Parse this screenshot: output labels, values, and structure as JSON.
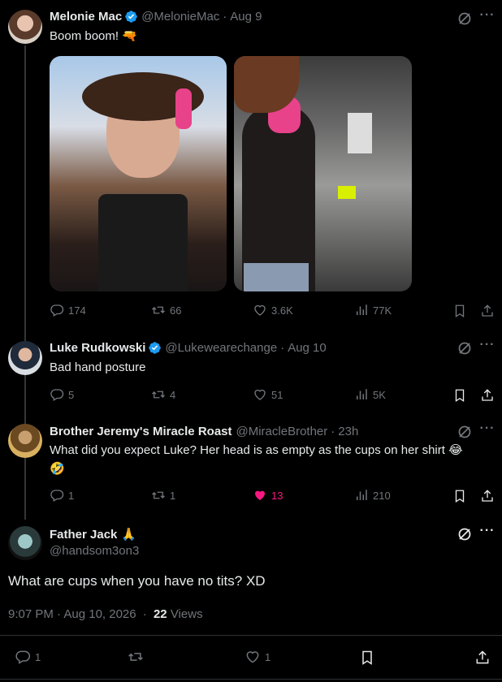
{
  "tweets": [
    {
      "name": "Melonie Mac",
      "handle": "@MelonieMac",
      "time": "Aug 9",
      "text": "Boom boom! 🔫",
      "replies": "174",
      "reposts": "66",
      "likes": "3.6K",
      "views": "77K"
    },
    {
      "name": "Luke Rudkowski",
      "handle": "@Lukewearechange",
      "time": "Aug 10",
      "text": "Bad hand posture",
      "replies": "5",
      "reposts": "4",
      "likes": "51",
      "views": "5K"
    },
    {
      "name": "Brother Jeremy's Miracle Roast",
      "handle": "@MiracleBrother",
      "time": "23h",
      "text_line1": "What did you expect Luke? Her head is as empty as the cups on her shirt 😂",
      "text_line2": "🤣",
      "replies": "1",
      "reposts": "1",
      "likes": "13",
      "views": "210"
    }
  ],
  "main": {
    "name": "Father Jack",
    "name_emoji": "🙏",
    "handle": "@handsom3on3",
    "text": "What are cups when you have no tits? XD",
    "datetime": "9:07 PM · Aug 10, 2026",
    "views_count": "22",
    "views_label": "Views",
    "replies": "1",
    "likes": "1"
  },
  "dot": "·",
  "colors": {
    "background": "#000000",
    "text": "#e7e9ea",
    "muted": "#71767b",
    "verified": "#1d9bf0",
    "like": "#f91880"
  },
  "icons": [
    "verified-badge-icon",
    "grok-icon",
    "more-icon",
    "reply-icon",
    "repost-icon",
    "like-icon",
    "views-icon",
    "bookmark-icon",
    "share-icon",
    "gun-emoji"
  ]
}
